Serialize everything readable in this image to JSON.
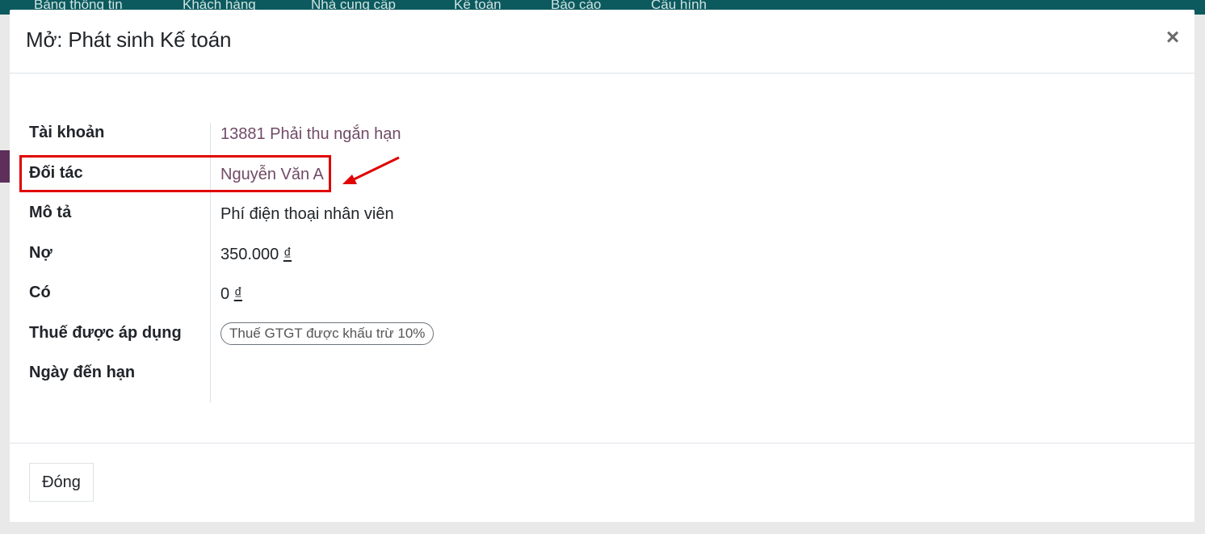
{
  "background": {
    "nav_items": [
      "Bảng thông tin",
      "Khách hàng",
      "Nhà cung cấp",
      "Kế toán",
      "Báo cáo",
      "Cấu hình"
    ]
  },
  "dialog": {
    "title": "Mở: Phát sinh Kế toán",
    "close_symbol": "×",
    "fields": {
      "account": {
        "label": "Tài khoản",
        "value": "13881 Phải thu ngắn hạn"
      },
      "partner": {
        "label": "Đối tác",
        "value": "Nguyễn Văn A"
      },
      "description": {
        "label": "Mô tả",
        "value": "Phí điện thoại nhân viên"
      },
      "debit": {
        "label": "Nợ",
        "value": "350.000",
        "currency": "₫"
      },
      "credit": {
        "label": "Có",
        "value": "0",
        "currency": "₫"
      },
      "taxes": {
        "label": "Thuế được áp dụng",
        "tag": "Thuế GTGT được khấu trừ 10%"
      },
      "due_date": {
        "label": "Ngày đến hạn",
        "value": ""
      }
    },
    "footer": {
      "close_label": "Đóng"
    }
  },
  "annotation": {
    "color": "#e00000",
    "highlight": "partner"
  },
  "colors": {
    "link": "#714b67",
    "nav": "#0c5a5e"
  }
}
